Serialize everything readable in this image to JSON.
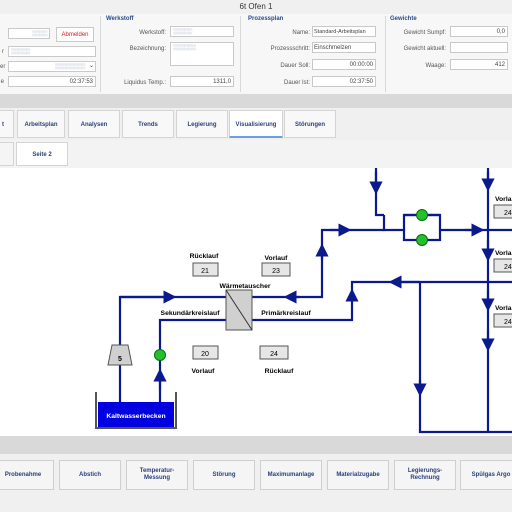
{
  "window": {
    "title": "6t Ofen 1"
  },
  "header": {
    "left": {
      "row1_label": "",
      "row2_label": "r",
      "row3_label": "er",
      "row4_label": "e",
      "row1_value": "▒▒▒▒",
      "row2_value": "▒▒▒▒▒",
      "row3_value": "▒▒▒▒▒▒▒▒",
      "row4_value": "02:37:53",
      "abmelden": "Abmelden"
    },
    "werkstoff": {
      "title": "Werkstoff",
      "werkstoff_label": "Werkstoff:",
      "werkstoff_value": "▒▒▒▒▒",
      "bezeichnung_label": "Bezeichnung:",
      "bezeichnung_value": "▒▒▒▒▒▒",
      "liquidus_label": "Liquidus Temp.:",
      "liquidus_value": "1311,0"
    },
    "prozessplan": {
      "title": "Prozessplan",
      "name_label": "Name:",
      "name_value": "Standard-Arbeitsplan",
      "schritt_label": "Prozessschritt:",
      "schritt_value": "Einschmelzen",
      "soll_label": "Dauer Soll:",
      "soll_value": "00:00:00",
      "ist_label": "Dauer Ist:",
      "ist_value": "02:37:50"
    },
    "gewichte": {
      "title": "Gewichte",
      "sumpf_label": "Gewicht Sumpf:",
      "sumpf_value": "0,0",
      "aktuell_label": "Gewicht aktuell:",
      "aktuell_value": "",
      "waage_label": "Waage:",
      "waage_value": "412"
    }
  },
  "tabs": [
    "t",
    "Arbeitsplan",
    "Analysen",
    "Trends",
    "Legierung",
    "Visualisierung",
    "Störungen"
  ],
  "active_tab": "Visualisierung",
  "subtabs": [
    "",
    "Seite 2"
  ],
  "diagram": {
    "ruecklauf_top_label": "Rücklauf",
    "ruecklauf_top_value": "21",
    "vorlauf_top_label": "Vorlauf",
    "vorlauf_top_value": "23",
    "waermetauscher_label": "Wärmetauscher",
    "sekundaer_label": "Sekundärkreislauf",
    "primaer_label": "Primärkreislauf",
    "vorlauf_bottom_label": "Vorlauf",
    "vorlauf_bottom_value": "20",
    "ruecklauf_bottom_label": "Rücklauf",
    "ruecklauf_bottom_value": "24",
    "tank_label": "Kaltwasserbecken",
    "pump_label": "5",
    "right_labels": [
      "Vorla",
      "Vorla",
      "Vorla"
    ],
    "right_values": [
      "24",
      "24",
      "24"
    ],
    "colors": {
      "pipe": "#0a1a8c",
      "tank": "#0000e0",
      "valve": "#22c02a"
    }
  },
  "bottom_buttons": [
    "Probenahme",
    "Abstich",
    "Temperatur-\nMessung",
    "Störung",
    "Maximumanlage",
    "Materialzugabe",
    "Legierungs-\nRechnung",
    "Spülgas Argo"
  ]
}
